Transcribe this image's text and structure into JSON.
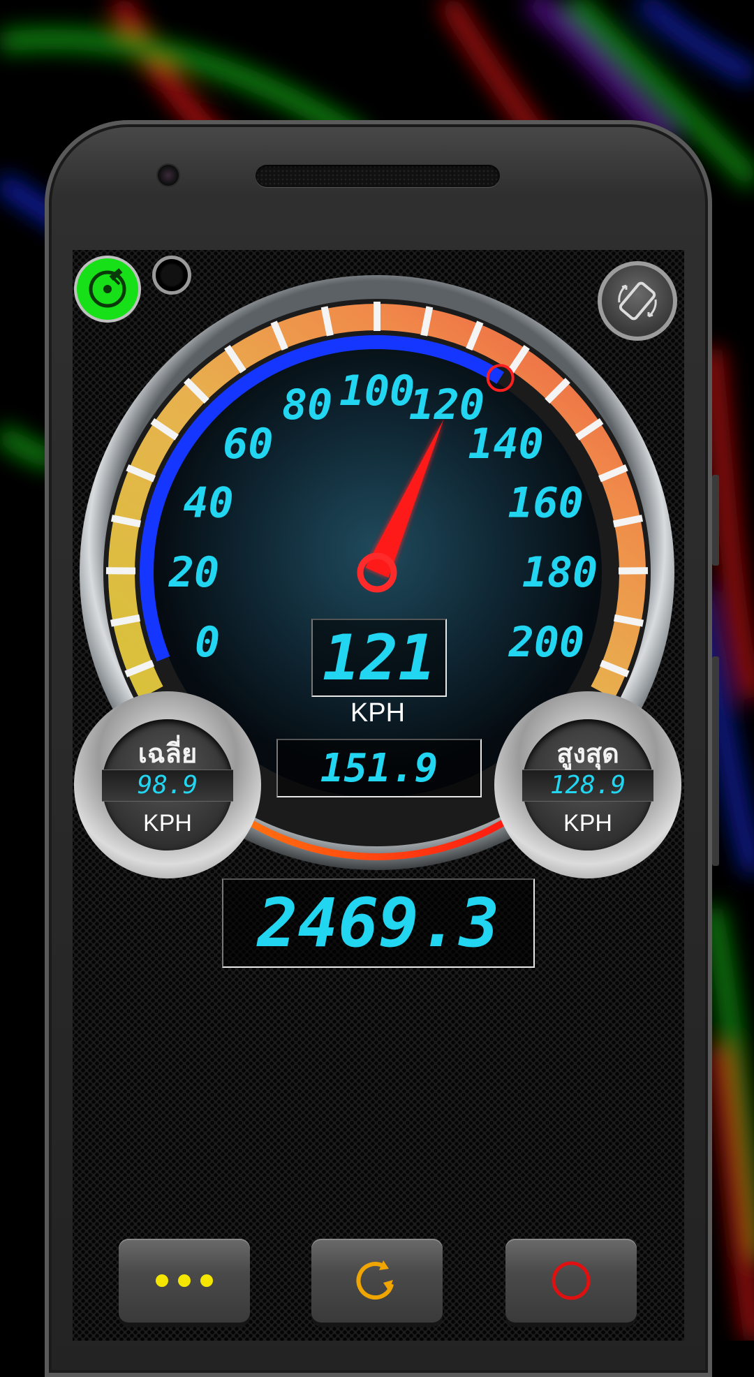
{
  "colors": {
    "lcd_text": "#22d6f2",
    "needle": "#ff1a1a",
    "gps_active": "#18e018",
    "arc_blue": "#1436ff",
    "menu_dots": "#f5e600",
    "reset_icon": "#f0a500",
    "record_icon": "#e01010"
  },
  "status": {
    "gps_icon": "gps-satellite-icon",
    "camera_icon": "camera-icon",
    "rotate_icon": "rotate-screen-icon"
  },
  "gauge": {
    "min": 0,
    "max": 200,
    "tick_labels": [
      "0",
      "20",
      "40",
      "60",
      "80",
      "100",
      "120",
      "140",
      "160",
      "180",
      "200"
    ],
    "needle_value": 121,
    "max_marker_value": 128.9,
    "speed": "121",
    "unit": "KPH",
    "secondary_value": "151.9"
  },
  "average": {
    "title": "เฉลี่ย",
    "value": "98.9",
    "unit": "KPH"
  },
  "maximum": {
    "title": "สูงสุด",
    "value": "128.9",
    "unit": "KPH"
  },
  "odometer": "2469.3",
  "buttons": {
    "menu_icon": "more-dots-icon",
    "reset_icon": "reset-refresh-icon",
    "record_icon": "record-circle-icon"
  }
}
